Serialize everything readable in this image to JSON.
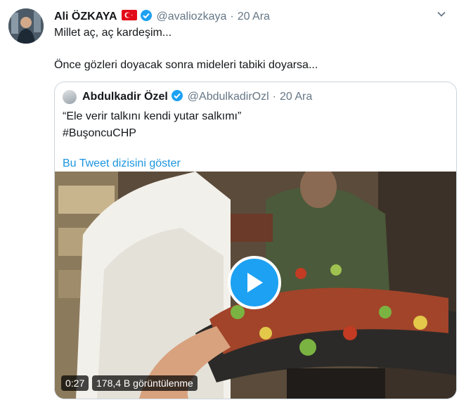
{
  "tweet": {
    "author_name": "Ali ÖZKAYA",
    "handle": "@avaliozkaya",
    "separator": "·",
    "date": "20 Ara",
    "text_line1": "Millet aç, aç kardeşim...",
    "text_line2": "Önce gözleri doyacak sonra mideleri tabiki doyarsa..."
  },
  "quoted": {
    "author_name": "Abdulkadir Özel",
    "handle": "@AbdulkadirOzl",
    "separator": "·",
    "date": "20 Ara",
    "text_line1": "“Ele verir talkını kendi yutar salkımı”",
    "text_line2": "#BuşoncuCHP",
    "thread_link": "Bu Tweet dizisini göster",
    "video": {
      "duration": "0:27",
      "views": "178,4 B görüntülenme"
    }
  },
  "colors": {
    "link": "#1b95e0",
    "verified": "#1da1f2",
    "play_button": "#1da1f2",
    "muted_text": "#657786"
  },
  "icons": [
    "turkey-flag-icon",
    "verified-badge-icon",
    "chevron-down-icon",
    "play-icon"
  ]
}
